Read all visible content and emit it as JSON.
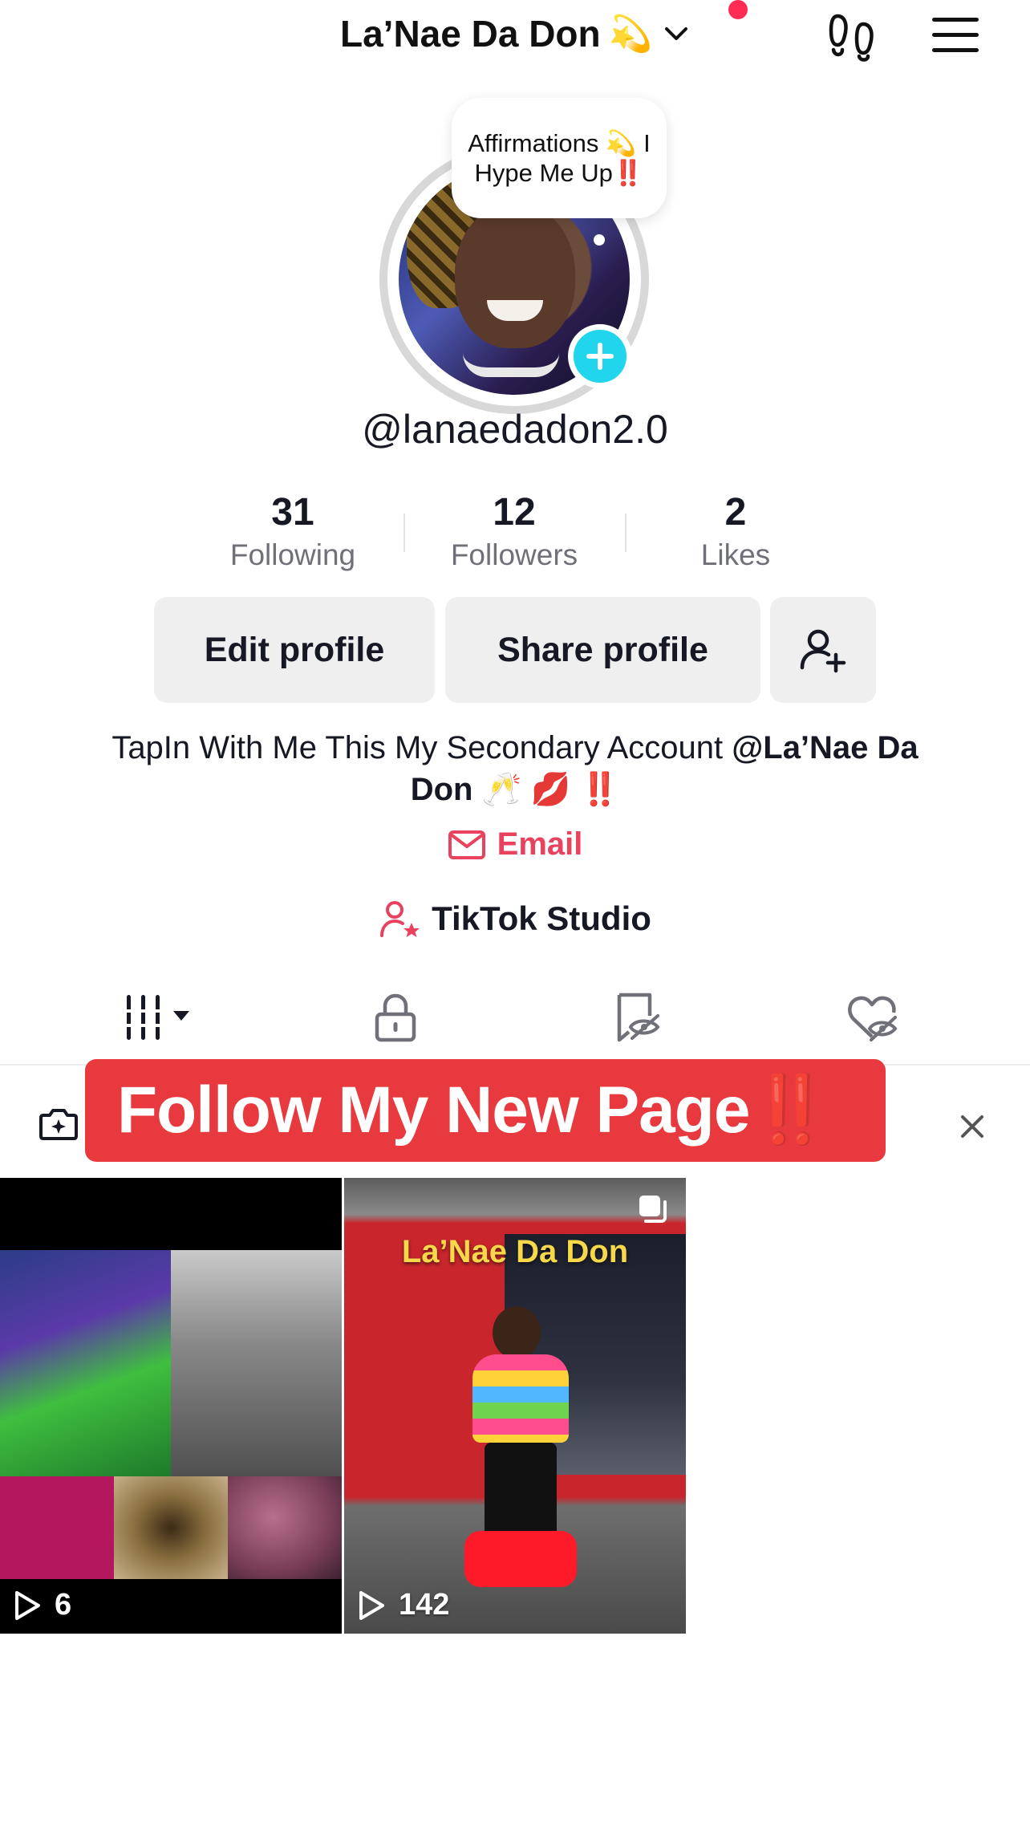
{
  "header": {
    "profile_name": "La’Nae Da Don",
    "profile_emoji": "💫",
    "has_notification": true
  },
  "profile": {
    "note_bubble": "Affirmations 💫 I Hype Me Up‼️",
    "username": "@lanaedadon2.0",
    "stats": [
      {
        "value": "31",
        "label": "Following"
      },
      {
        "value": "12",
        "label": "Followers"
      },
      {
        "value": "2",
        "label": "Likes"
      }
    ],
    "buttons": {
      "edit": "Edit profile",
      "share": "Share profile"
    },
    "bio_text": "TapIn With Me This My Secondary Account ",
    "bio_mention": "@La’Nae Da Don",
    "bio_emojis": " 🥂 💋 ‼️",
    "email_label": "Email",
    "studio_label": "TikTok Studio"
  },
  "banner": {
    "text": "Follow My New Page‼️"
  },
  "videos": [
    {
      "views": "6"
    },
    {
      "views": "142",
      "caption": "La’Nae Da Don"
    }
  ],
  "colors": {
    "accent_red": "#fe2c55",
    "email_red": "#e8425f",
    "banner_red": "#e8393f",
    "avatar_add": "#20d5ec",
    "text_primary": "#161823",
    "text_secondary": "#6f7078"
  }
}
